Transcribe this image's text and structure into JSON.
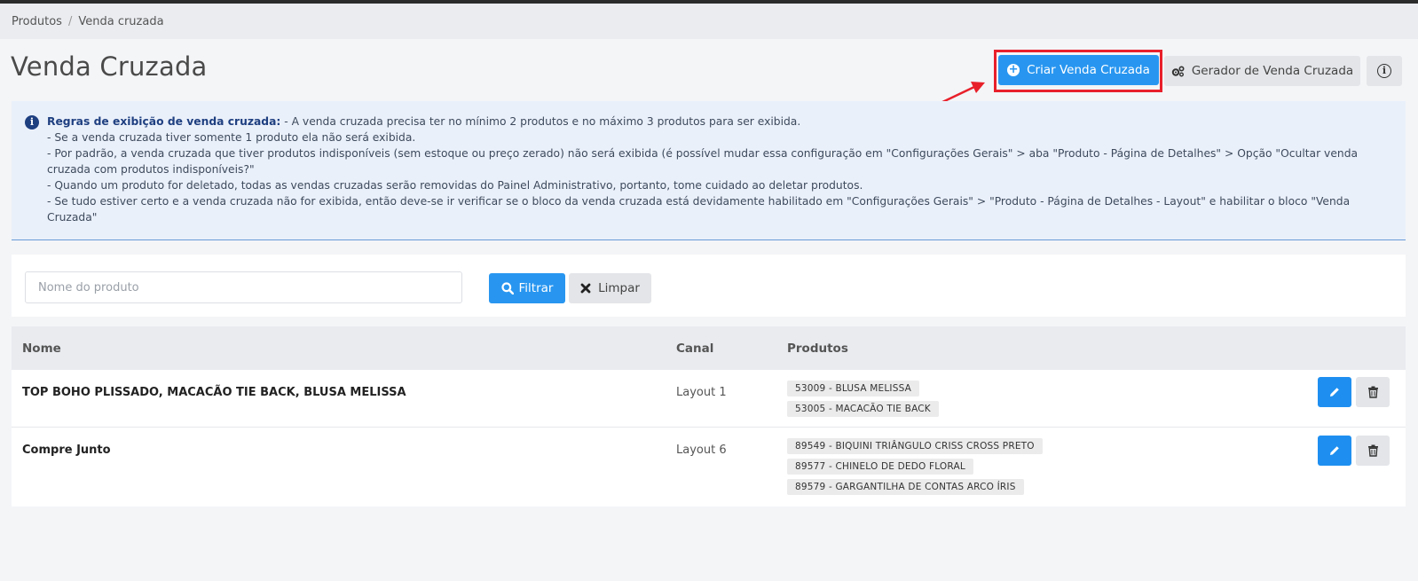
{
  "breadcrumb": {
    "items": [
      "Produtos",
      "Venda cruzada"
    ],
    "separator": "/"
  },
  "header": {
    "title": "Venda Cruzada",
    "create_button": "Criar Venda Cruzada",
    "generator_button": "Gerador de Venda Cruzada",
    "info_button_icon": "i"
  },
  "rules": {
    "title": "Regras de exibição de venda cruzada:",
    "lines": [
      " - A venda cruzada precisa ter no mínimo 2 produtos e no máximo 3 produtos para ser exibida.",
      "- Se a venda cruzada tiver somente 1 produto ela não será exibida.",
      "- Por padrão, a venda cruzada que tiver produtos indisponíveis (sem estoque ou preço zerado) não será exibida (é possível mudar essa configuração em \"Configurações Gerais\" > aba \"Produto - Página de Detalhes\" > Opção \"Ocultar venda cruzada com produtos indisponíveis?\"",
      "- Quando um produto for deletado, todas as vendas cruzadas serão removidas do Painel Administrativo, portanto, tome cuidado ao deletar produtos.",
      "- Se tudo estiver certo e a venda cruzada não for exibida, então deve-se ir verificar se o bloco da venda cruzada está devidamente habilitado em \"Configurações Gerais\" > \"Produto - Página de Detalhes - Layout\" e habilitar o bloco \"Venda Cruzada\""
    ]
  },
  "filter": {
    "placeholder": "Nome do produto",
    "value": "",
    "filter_button": "Filtrar",
    "clear_button": "Limpar"
  },
  "table": {
    "columns": [
      "Nome",
      "Canal",
      "Produtos"
    ],
    "rows": [
      {
        "name": "TOP BOHO PLISSADO, MACACÃO TIE BACK, BLUSA MELISSA",
        "canal": "Layout 1",
        "products": [
          "53009 - BLUSA MELISSA",
          "53005 - MACACÃO TIE BACK"
        ]
      },
      {
        "name": "Compre Junto",
        "canal": "Layout 6",
        "products": [
          "89549 - BIQUINI TRIÂNGULO CRISS CROSS PRETO",
          "89577 - CHINELO DE DEDO FLORAL",
          "89579 - GARGANTILHA DE CONTAS ARCO ÍRIS"
        ]
      }
    ]
  },
  "colors": {
    "primary": "#2896f0",
    "highlight": "#e8202a",
    "rules_bg": "#eaf0fa",
    "rules_title": "#1e3f80"
  },
  "icons": {
    "create": "plus-circle-icon",
    "generator": "gears-icon",
    "info": "info-icon",
    "filter": "search-icon",
    "clear": "close-icon",
    "edit": "pencil-icon",
    "delete": "trash-icon",
    "annotation": "red-arrow"
  }
}
